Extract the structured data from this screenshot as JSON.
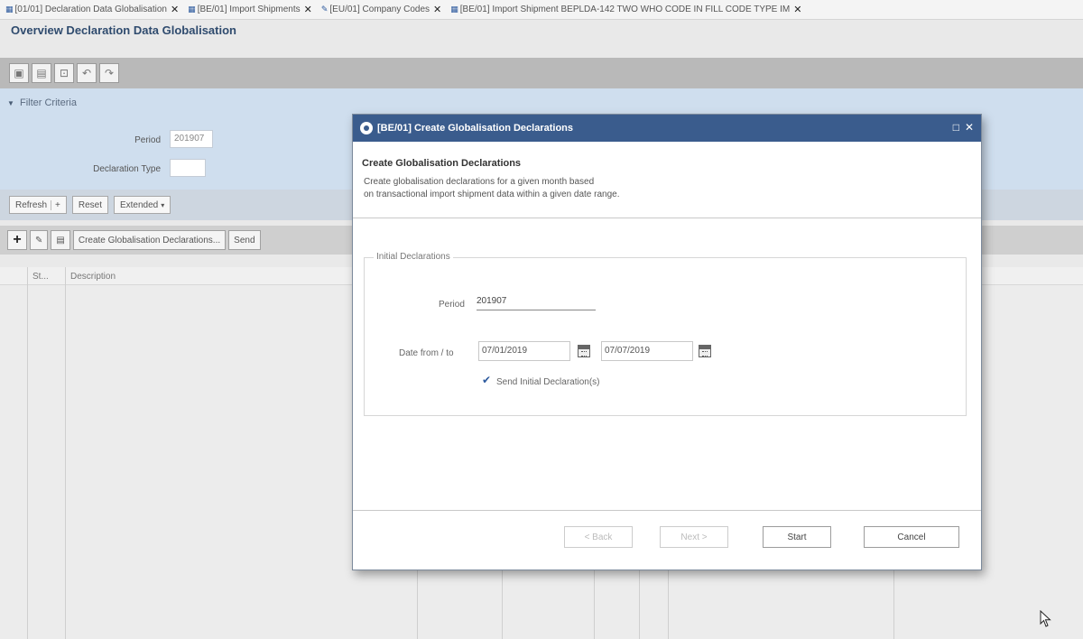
{
  "tabs": [
    {
      "label": "[01/01] Declaration Data Globalisation"
    },
    {
      "label": "[BE/01] Import Shipments"
    },
    {
      "label": "[EU/01] Company Codes"
    },
    {
      "label": "[BE/01] Import Shipment BEPLDA-142 TWO WHO CODE IN FILL CODE TYPE IM"
    }
  ],
  "page_title": "Overview Declaration Data Globalisation",
  "filter": {
    "header": "Filter Criteria",
    "period_label": "Period",
    "period_value": "201907",
    "decl_type_label": "Declaration Type"
  },
  "button_bar": {
    "refresh": "Refresh",
    "refresh_toggle": "+",
    "reset": "Reset",
    "extended": "Extended"
  },
  "table_toolbar": {
    "create_btn": "Create Globalisation Declarations...",
    "send_btn": "Send"
  },
  "grid": {
    "col_st": "St...",
    "col_description": "Description"
  },
  "dialog": {
    "title": "[BE/01] Create Globalisation Declarations",
    "ctrl_restore": "□",
    "ctrl_close": "✕",
    "heading": "Create Globalisation Declarations",
    "desc_line1": "Create globalisation declarations for a given month based",
    "desc_line2": "on transactional import shipment data within a given date range.",
    "fieldset_legend": "Initial Declarations",
    "period_label": "Period",
    "period_value": "201907",
    "date_label": "Date from / to",
    "date_from": "07/01/2019",
    "date_to": "07/07/2019",
    "send_initial_label": "Send Initial Declaration(s)",
    "back_btn": "< Back",
    "next_btn": "Next >",
    "start_btn": "Start",
    "cancel_btn": "Cancel"
  }
}
